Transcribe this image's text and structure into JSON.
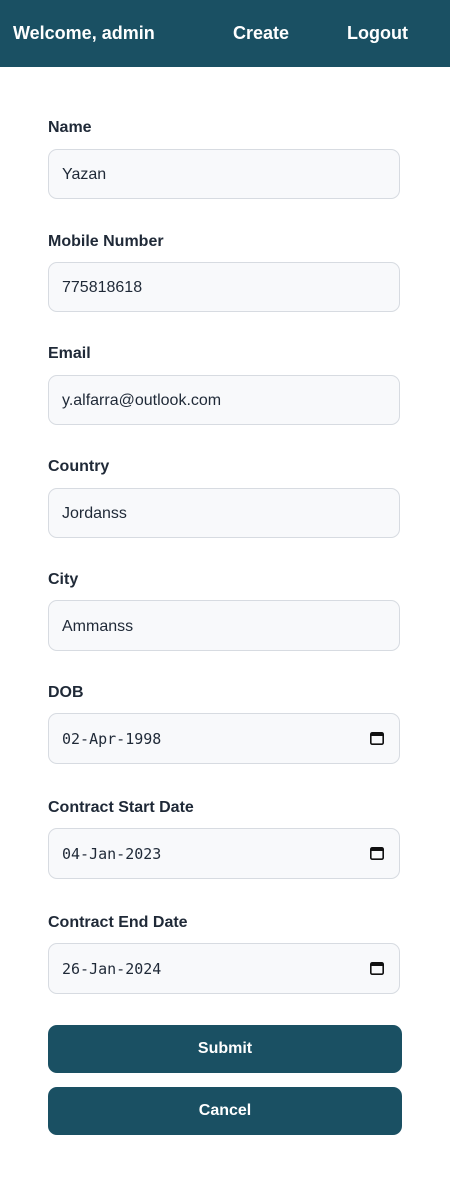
{
  "nav": {
    "welcome": "Welcome, admin",
    "create": "Create",
    "logout": "Logout"
  },
  "form": {
    "name": {
      "label": "Name",
      "value": "Yazan"
    },
    "mobile": {
      "label": "Mobile Number",
      "value": "775818618"
    },
    "email": {
      "label": "Email",
      "value": "y.alfarra@outlook.com"
    },
    "country": {
      "label": "Country",
      "value": "Jordanss"
    },
    "city": {
      "label": "City",
      "value": "Ammanss"
    },
    "dob": {
      "label": "DOB",
      "value": "02-Apr-1998",
      "icon": "calendar-icon"
    },
    "contract_start": {
      "label": "Contract Start Date",
      "value": "04-Jan-2023",
      "icon": "calendar-icon"
    },
    "contract_end": {
      "label": "Contract End Date",
      "value": "26-Jan-2024",
      "icon": "calendar-icon"
    }
  },
  "buttons": {
    "submit": "Submit",
    "cancel": "Cancel"
  },
  "colors": {
    "primary": "#1a5063",
    "input_bg": "#f8f9fb",
    "input_border": "#d7dbe1",
    "text": "#1f2937"
  }
}
